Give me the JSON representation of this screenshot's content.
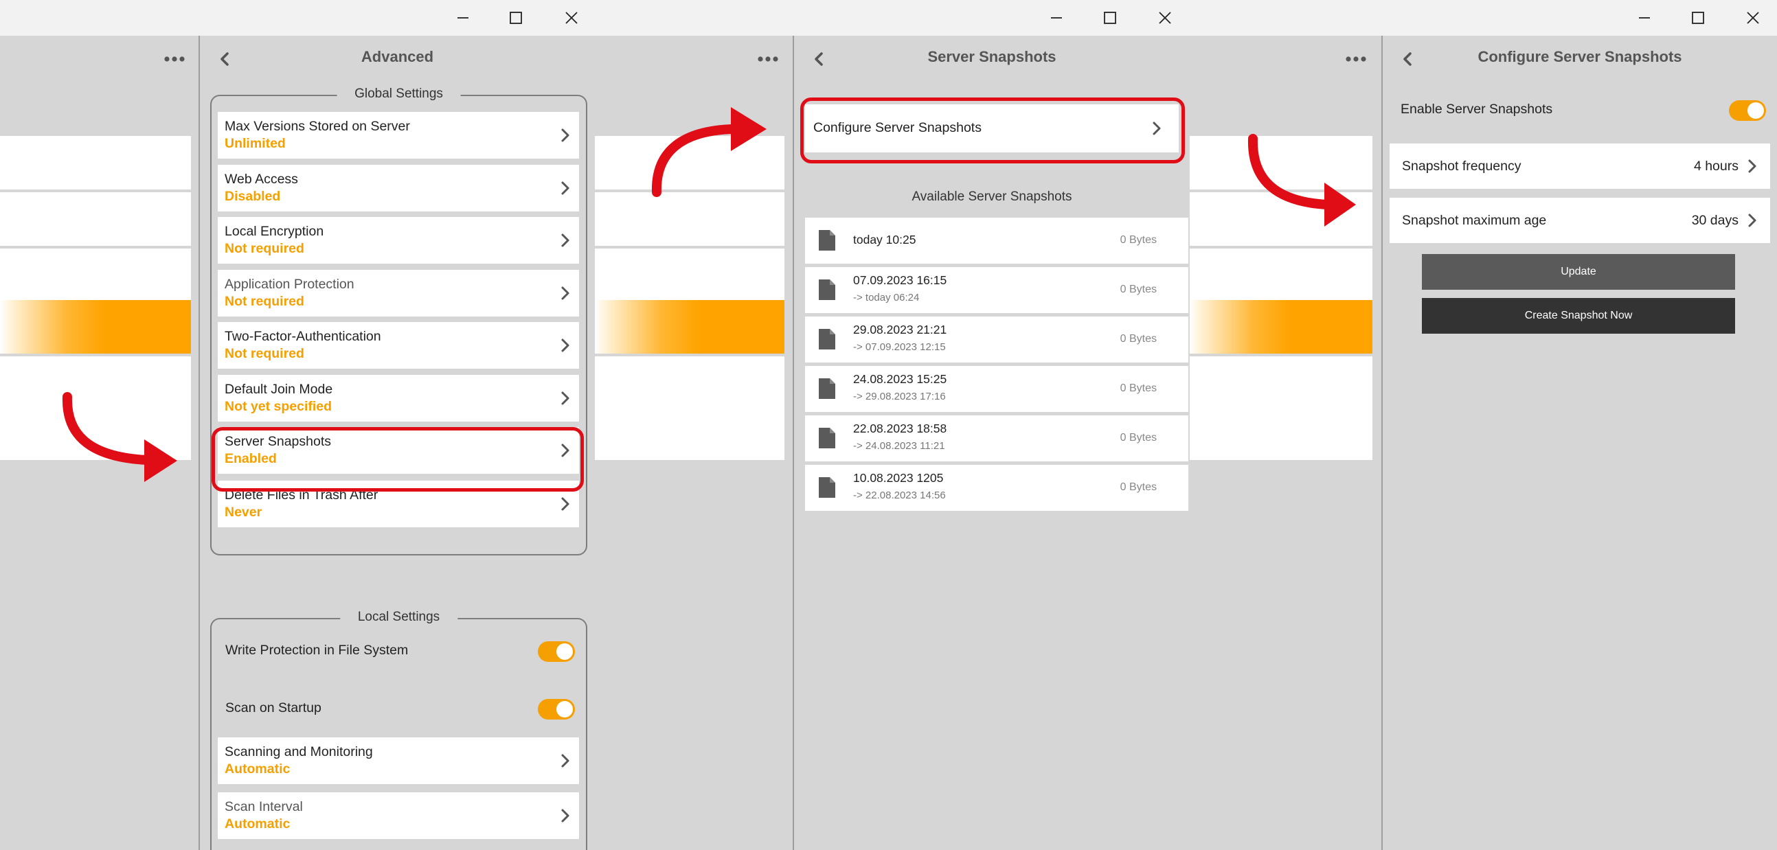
{
  "panel1": {
    "title": "Advanced",
    "global_settings_label": "Global Settings",
    "global_items": [
      {
        "label": "Max Versions Stored on Server",
        "value": "Unlimited"
      },
      {
        "label": "Web Access",
        "value": "Disabled"
      },
      {
        "label": "Local Encryption",
        "value": "Not required"
      },
      {
        "label": "Application Protection",
        "value": "Not required"
      },
      {
        "label": "Two-Factor-Authentication",
        "value": "Not required"
      },
      {
        "label": "Default Join Mode",
        "value": "Not yet specified"
      },
      {
        "label": "Server Snapshots",
        "value": "Enabled"
      },
      {
        "label": "Delete Files in Trash After",
        "value": "Never"
      }
    ],
    "local_settings_label": "Local Settings",
    "toggles": [
      {
        "label": "Write Protection in File System",
        "on": true
      },
      {
        "label": "Scan on Startup",
        "on": true
      }
    ],
    "local_items": [
      {
        "label": "Scanning and Monitoring",
        "value": "Automatic"
      },
      {
        "label": "Scan Interval",
        "value": "Automatic"
      }
    ]
  },
  "panel2": {
    "title": "Server Snapshots",
    "configure_label": "Configure Server Snapshots",
    "available_label": "Available Server Snapshots",
    "snapshots": [
      {
        "date": "today 10:25",
        "sub": "",
        "size": "0 Bytes"
      },
      {
        "date": "07.09.2023 16:15",
        "sub": "-> today 06:24",
        "size": "0 Bytes"
      },
      {
        "date": "29.08.2023 21:21",
        "sub": "-> 07.09.2023 12:15",
        "size": "0 Bytes"
      },
      {
        "date": "24.08.2023 15:25",
        "sub": "-> 29.08.2023 17:16",
        "size": "0 Bytes"
      },
      {
        "date": "22.08.2023 18:58",
        "sub": "-> 24.08.2023 11:21",
        "size": "0 Bytes"
      },
      {
        "date": "10.08.2023 1205",
        "sub": "-> 22.08.2023 14:56",
        "size": "0 Bytes"
      }
    ]
  },
  "panel3": {
    "title": "Configure Server Snapshots",
    "enable_label": "Enable Server Snapshots",
    "enable_on": true,
    "frequency_label": "Snapshot frequency",
    "frequency_value": "4 hours",
    "max_age_label": "Snapshot maximum age",
    "max_age_value": "30 days",
    "update_label": "Update",
    "create_label": "Create Snapshot Now"
  },
  "colors": {
    "accent": "#f5a000",
    "highlight": "#e10d16",
    "background": "#d6d6d6",
    "update_button": "#5a5a5a",
    "create_button": "#333333"
  },
  "icons": {
    "window": [
      "minimize-icon",
      "maximize-icon",
      "close-icon"
    ],
    "more": "more-dots-icon",
    "back": "chevron-left-icon",
    "row": "chevron-right-icon",
    "file": "file-icon",
    "annotation": "red-curved-arrow-icon"
  }
}
